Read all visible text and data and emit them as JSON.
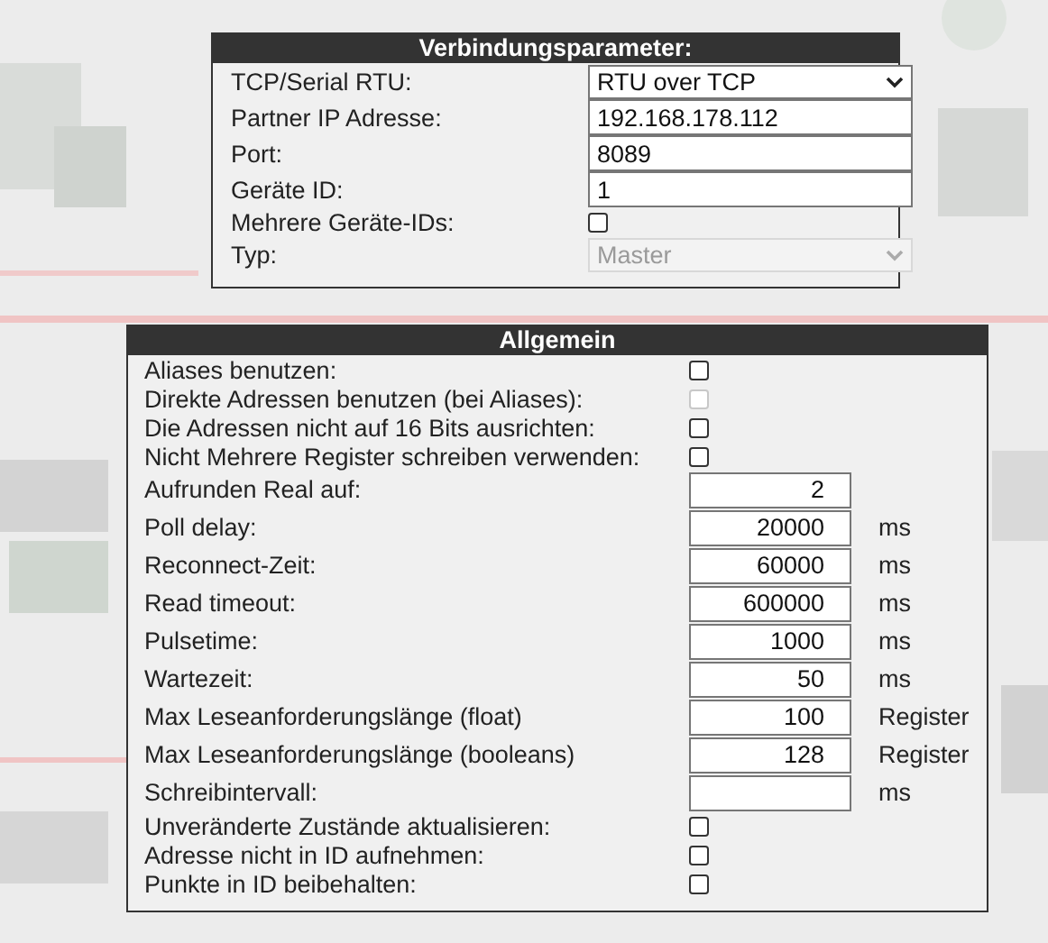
{
  "connection": {
    "title": "Verbindungsparameter:",
    "fields": [
      {
        "kind": "select",
        "label": "TCP/Serial RTU:",
        "value": "RTU over TCP",
        "disabled": false
      },
      {
        "kind": "text",
        "label": "Partner IP Adresse:",
        "value": "192.168.178.112"
      },
      {
        "kind": "text",
        "label": "Port:",
        "value": "8089"
      },
      {
        "kind": "text",
        "label": "Geräte ID:",
        "value": "1"
      },
      {
        "kind": "checkbox",
        "label": "Mehrere Geräte-IDs:",
        "checked": false,
        "disabled": false
      },
      {
        "kind": "select",
        "label": "Typ:",
        "value": "Master",
        "disabled": true
      }
    ]
  },
  "general": {
    "title": "Allgemein",
    "fields": [
      {
        "kind": "checkbox",
        "label": "Aliases benutzen:",
        "checked": false,
        "disabled": false
      },
      {
        "kind": "checkbox",
        "label": "Direkte Adressen benutzen (bei Aliases):",
        "checked": false,
        "disabled": true
      },
      {
        "kind": "checkbox",
        "label": "Die Adressen nicht auf 16 Bits ausrichten:",
        "checked": false,
        "disabled": false
      },
      {
        "kind": "checkbox",
        "label": "Nicht Mehrere Register schreiben verwenden:",
        "checked": false,
        "disabled": false
      },
      {
        "kind": "number",
        "label": "Aufrunden Real auf:",
        "value": "2"
      },
      {
        "kind": "number",
        "label": "Poll delay:",
        "value": "20000",
        "unit": "ms"
      },
      {
        "kind": "number",
        "label": "Reconnect-Zeit:",
        "value": "60000",
        "unit": "ms"
      },
      {
        "kind": "number",
        "label": "Read timeout:",
        "value": "600000",
        "unit": "ms"
      },
      {
        "kind": "number",
        "label": "Pulsetime:",
        "value": "1000",
        "unit": "ms"
      },
      {
        "kind": "number",
        "label": "Wartezeit:",
        "value": "50",
        "unit": "ms"
      },
      {
        "kind": "number",
        "label": "Max Leseanforderungslänge (float)",
        "value": "100",
        "unit": "Register"
      },
      {
        "kind": "number",
        "label": "Max Leseanforderungslänge (booleans)",
        "value": "128",
        "unit": "Register"
      },
      {
        "kind": "number",
        "label": "Schreibintervall:",
        "unit": "ms"
      },
      {
        "kind": "checkbox",
        "label": "Unveränderte Zustände aktualisieren:",
        "checked": false,
        "disabled": false
      },
      {
        "kind": "checkbox",
        "label": "Adresse nicht in ID aufnehmen:",
        "checked": false,
        "disabled": false
      },
      {
        "kind": "checkbox",
        "label": "Punkte in ID beibehalten:",
        "checked": false,
        "disabled": false
      }
    ]
  }
}
